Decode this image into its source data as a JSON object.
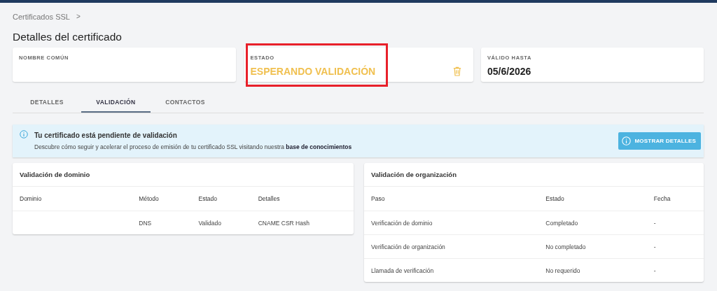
{
  "breadcrumb": {
    "items": [
      "Certificados SSL"
    ],
    "separator": ">"
  },
  "title": "Detalles del certificado",
  "cards": [
    {
      "kind": "text",
      "label": "NOMBRE COMÚN",
      "highlighted": false
    },
    {
      "kind": "status",
      "label": "ESTADO",
      "value": "ESPERANDO VALIDACIÓN",
      "color": "#f0c050",
      "highlighted": true
    },
    {
      "kind": "text",
      "label": "VÁLIDO HASTA",
      "value": "05/6/2026",
      "highlighted": false
    }
  ],
  "tabs": [
    {
      "label": "DETALLES",
      "selected": false
    },
    {
      "label": "VALIDACIÓN",
      "selected": true
    },
    {
      "label": "CONTACTOS",
      "selected": false
    }
  ],
  "alert": {
    "title": "Tu certificado está pendiente de validación",
    "message": "Descubre cómo seguir y acelerar el proceso de emisión de tu certificado SSL visitando nuestra **base de conocimientos**",
    "button": "MOSTRAR DETALLES"
  },
  "panels": [
    {
      "title": "Validación de dominio",
      "columns": [
        "Dominio",
        "Método",
        "Estado",
        "Detalles"
      ],
      "rows": [
        [
          "",
          "DNS",
          "Validado",
          "CNAME CSR Hash"
        ]
      ]
    },
    {
      "title": "Validación de organización",
      "columns": [
        "Paso",
        "Estado",
        "Fecha"
      ],
      "rows": [
        [
          "Verificación de dominio",
          "Completado",
          "-"
        ],
        [
          "Verificación de organización",
          "No completado",
          "-"
        ],
        [
          "Llamada de verificación",
          "No requerido",
          "-"
        ]
      ]
    }
  ]
}
